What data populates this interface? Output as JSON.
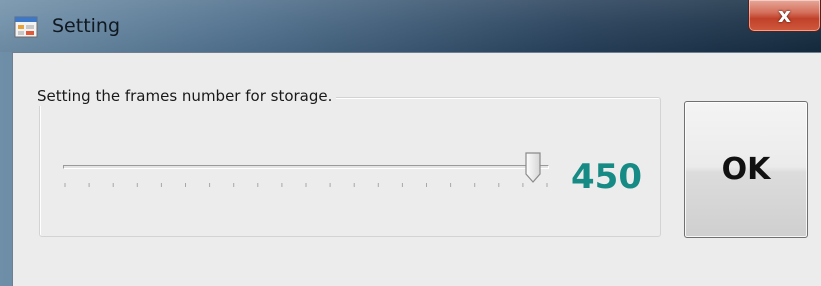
{
  "window": {
    "title": "Setting",
    "close_label": "x"
  },
  "group": {
    "label": "Setting the frames number for storage."
  },
  "slider": {
    "value_text": "450",
    "position_fraction": 0.97,
    "tick_count": 21
  },
  "button": {
    "ok_label": "OK"
  },
  "colors": {
    "value_color": "#168a84",
    "client_background": "#ececec",
    "titlebar_dark": "#152a3e"
  },
  "icons": {
    "app": "form-window-icon",
    "close": "close-icon",
    "thumb": "slider-thumb"
  }
}
